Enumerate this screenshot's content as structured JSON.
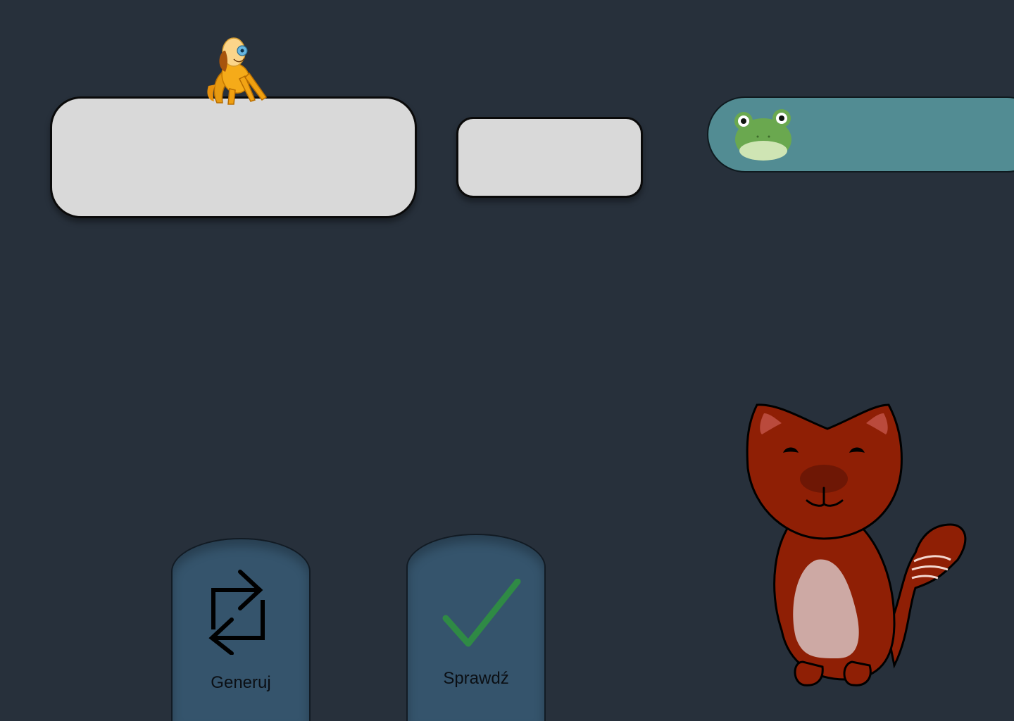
{
  "drop_zones": {
    "large": {
      "content": ""
    },
    "small": {
      "content": ""
    }
  },
  "progress_track": {
    "marker_icon": "frog-icon",
    "color": "#528c93"
  },
  "actions": {
    "generate": {
      "label": "Generuj",
      "icon": "repeat-arrows-icon"
    },
    "check": {
      "label": "Sprawdź",
      "icon": "checkmark-icon",
      "icon_color": "#2f8a45"
    }
  },
  "characters": {
    "dog": "dog-icon",
    "fox": "fox-icon"
  },
  "colors": {
    "background": "#27303b",
    "slot": "#d9d9d9",
    "button": "#35546c"
  }
}
